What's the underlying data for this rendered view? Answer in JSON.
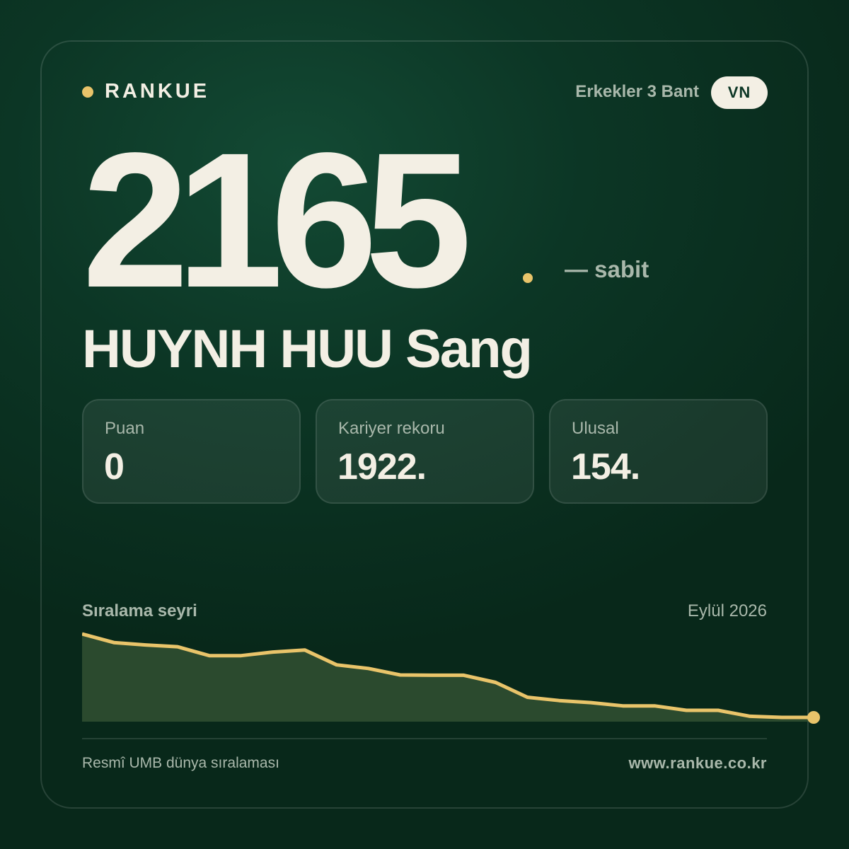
{
  "brand": {
    "name": "RANKUE"
  },
  "header": {
    "category": "Erkekler 3 Bant",
    "country": "VN"
  },
  "player": {
    "rank": "2165",
    "trend": "— sabit",
    "name": "HUYNH HUU Sang"
  },
  "stats": [
    {
      "label": "Puan",
      "value": "0"
    },
    {
      "label": "Kariyer rekoru",
      "value": "1922."
    },
    {
      "label": "Ulusal",
      "value": "154."
    }
  ],
  "chart_data": {
    "type": "area",
    "title": "Sıralama seyri",
    "date": "Eylül 2026",
    "xlabel": "",
    "ylabel": "",
    "invert_y": true,
    "ylim": [
      1885,
      2180
    ],
    "values": [
      1885,
      1914,
      1922,
      1928,
      1958,
      1958,
      1946,
      1939,
      1989,
      2001,
      2023,
      2024,
      2024,
      2048,
      2098,
      2109,
      2116,
      2127,
      2127,
      2142,
      2142,
      2162,
      2190,
      2190
    ],
    "colors": {
      "line": "#e9c46a",
      "fill": "#2b4a2e"
    }
  },
  "footer": {
    "source": "Resmî UMB dünya sıralaması",
    "url": "www.rankue.co.kr"
  }
}
